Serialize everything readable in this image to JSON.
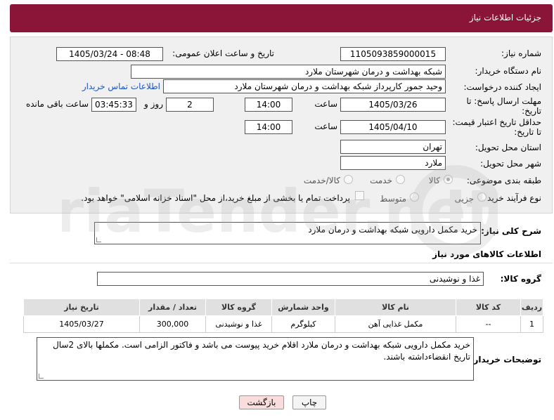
{
  "header": {
    "title": "جزئیات اطلاعات نیاز"
  },
  "form": {
    "need_number_label": "شماره نیاز:",
    "need_number": "1105093859000015",
    "announce_label": "تاریخ و ساعت اعلان عمومی:",
    "announce_value": "1405/03/24 - 08:48",
    "buyer_org_label": "نام دستگاه خریدار:",
    "buyer_org": "شبکه بهداشت و درمان شهرستان ملارد",
    "creator_label": "ایجاد کننده درخواست:",
    "creator": "وحید جمور کارپرداز شبکه بهداشت و درمان شهرستان ملارد",
    "contact_link": "اطلاعات تماس خریدار",
    "reply_deadline_label": "مهلت ارسال پاسخ: تا تاریخ:",
    "reply_date": "1405/03/26",
    "time_label": "ساعت",
    "reply_time": "14:00",
    "days_value": "2",
    "days_label": "روز و",
    "remaining_time": "03:45:33",
    "remaining_label": "ساعت باقی مانده",
    "price_validity_label": "حداقل تاریخ اعتبار قیمت: تا تاریخ:",
    "price_date": "1405/04/10",
    "price_time": "14:00",
    "province_label": "استان محل تحویل:",
    "province": "تهران",
    "city_label": "شهر محل تحویل:",
    "city": "ملارد",
    "category_label": "طبقه بندی موضوعی:",
    "category_options": [
      "کالا",
      "خدمت",
      "کالا/خدمت"
    ],
    "process_label": "نوع فرآیند خرید :",
    "process_options": [
      "جزیی",
      "متوسط"
    ],
    "payment_note": "پرداخت تمام یا بخشی از مبلغ خرید،از محل \"اسناد خزانه اسلامی\" خواهد بود."
  },
  "description": {
    "label": "شرح کلی نیاز:",
    "value": "خرید مکمل دارویی شبکه بهداشت و درمان ملارد"
  },
  "goods": {
    "section_title": "اطلاعات کالاهای مورد نیاز",
    "group_label": "گروه کالا:",
    "group_value": "غذا و نوشیدنی",
    "columns": [
      "ردیف",
      "کد کالا",
      "نام کالا",
      "واحد شمارش",
      "گروه کالا",
      "تعداد / مقدار",
      "تاریخ نیاز"
    ],
    "rows": [
      [
        "1",
        "--",
        "مکمل غذایی آهن",
        "کیلوگرم",
        "غذا و نوشیدنی",
        "300,000",
        "1405/03/27"
      ]
    ]
  },
  "buyer_notes": {
    "label": "توضیحات خریدار:",
    "value": "خرید مکمل دارویی شبکه بهداشت و درمان ملارد اقلام خرید پیوست می باشد و فاکتور الزامی است. مکملها بالای 2سال تاریخ انقضاءداشته باشند."
  },
  "buttons": {
    "print": "چاپ",
    "back": "بازگشت"
  },
  "watermark": {
    "text": "AriaTender.net"
  },
  "colors": {
    "header_bg": "#8b1538",
    "link": "#1a56c4",
    "back_button_bg": "#f9dcdc"
  }
}
